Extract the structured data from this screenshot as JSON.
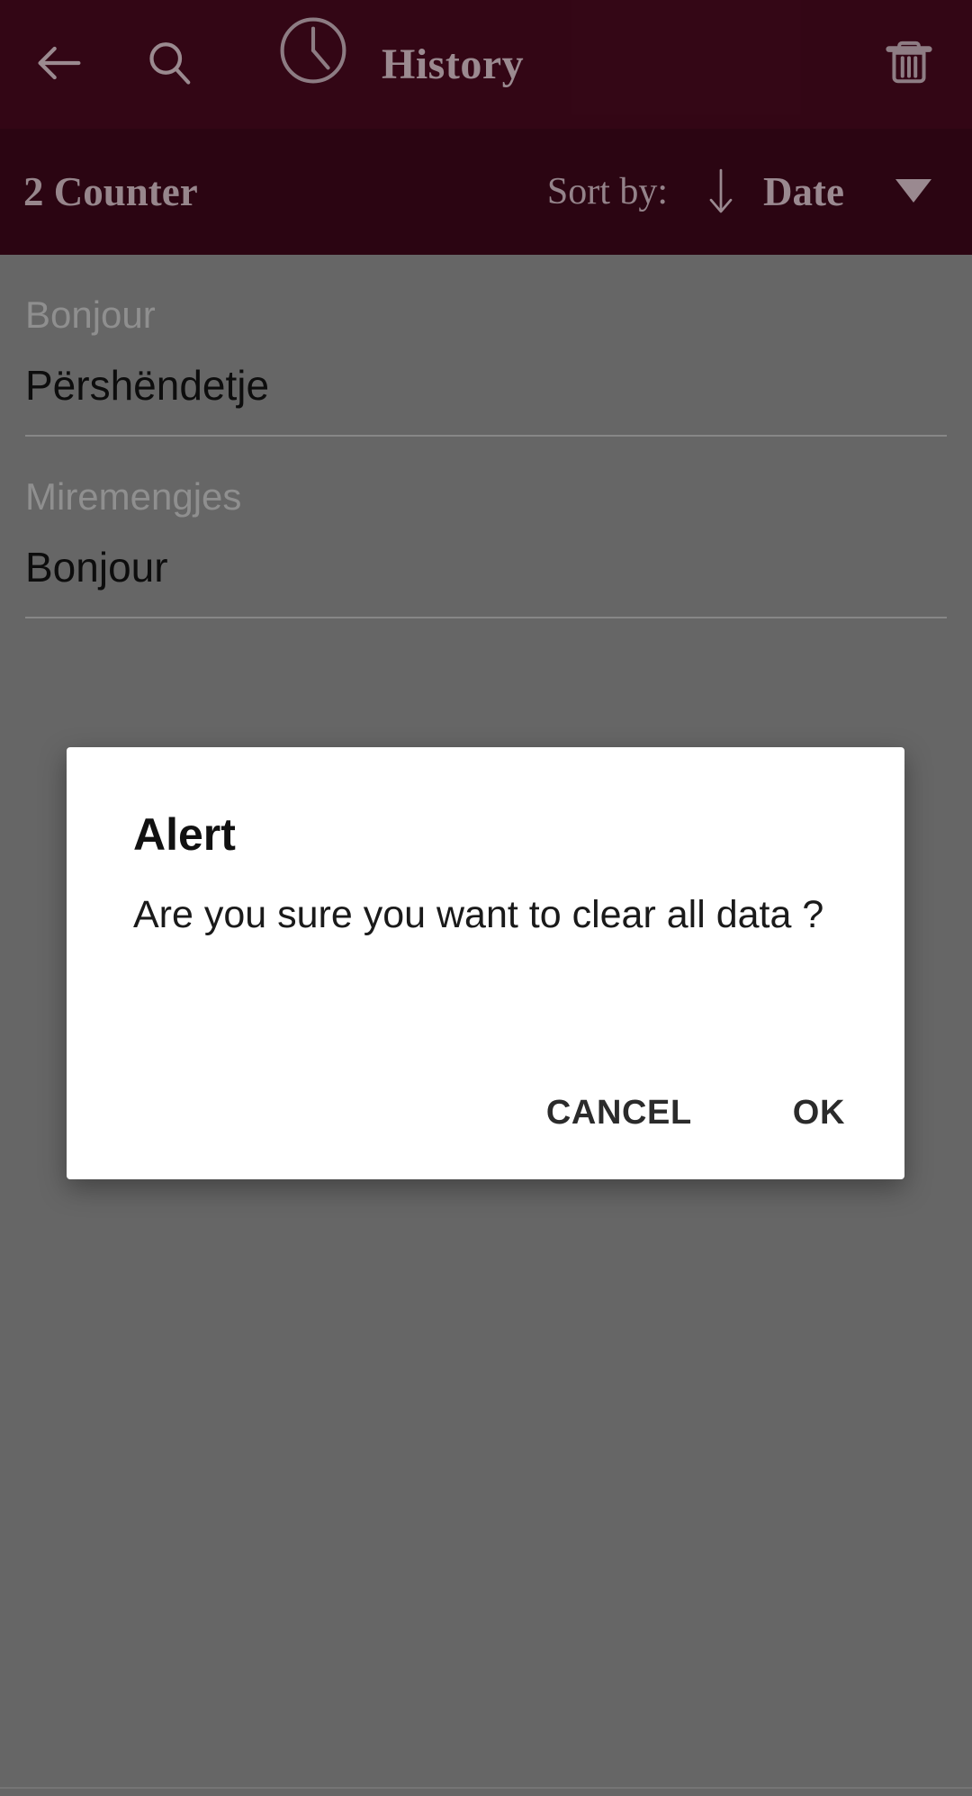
{
  "colors": {
    "appbar_bg": "#4a0a1f",
    "subbar_bg": "#42091c",
    "scrim": "#666666",
    "appbar_fg": "#9b8a90",
    "dialog_bg": "#ffffff",
    "dialog_text": "#111111",
    "source_text": "#8f8f8f",
    "target_text": "#0d0d0d"
  },
  "appbar": {
    "back_icon": "arrow-left-icon",
    "search_icon": "search-icon",
    "clock_icon": "clock-icon",
    "title": "History",
    "delete_icon": "trash-icon"
  },
  "subbar": {
    "counter": "2 Counter",
    "sort_label": "Sort by:",
    "sort_direction_icon": "arrow-down-icon",
    "sort_value": "Date",
    "dropdown_icon": "caret-down-icon"
  },
  "history": {
    "items": [
      {
        "source": "Bonjour",
        "target": "Përshëndetje"
      },
      {
        "source": "Miremengjes",
        "target": "Bonjour"
      }
    ]
  },
  "dialog": {
    "title": "Alert",
    "message": "Are you sure you want to clear all data ?",
    "cancel_label": "CANCEL",
    "ok_label": "OK"
  }
}
